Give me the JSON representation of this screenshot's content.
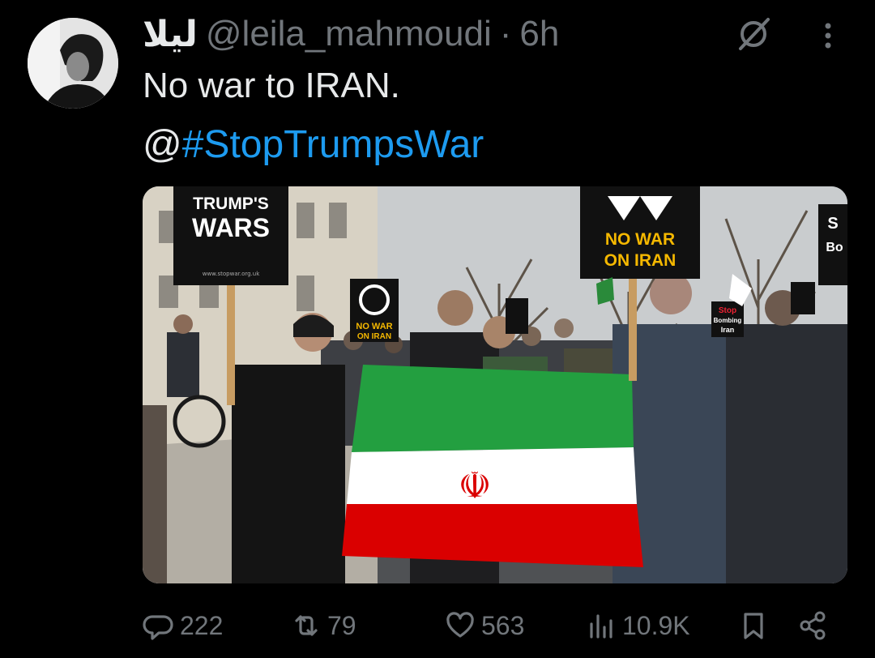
{
  "author": {
    "display_name": "ليلا",
    "handle": "@leila_mahmoudi",
    "separator": "·",
    "time": "6h"
  },
  "tweet": {
    "text": "No war to IRAN.",
    "mention_prefix": "@",
    "hashtag": "#StopTrumpsWar"
  },
  "media": {
    "sign_left_line1": "TRUMP'S",
    "sign_left_line2": "WARS",
    "sign_left_url": "www.stopwar.org.uk",
    "sign_right_line1": "NO WAR",
    "sign_right_line2": "ON IRAN",
    "sign_small_line1": "NO WAR",
    "sign_small_line2": "ON IRAN",
    "sign_far_right_line1": "S",
    "sign_far_right_line2": "Bo",
    "sign_stop": "Stop",
    "sign_bombing": "Bombing",
    "sign_iran": "Iran"
  },
  "actions": {
    "replies": "222",
    "reposts": "79",
    "likes": "563",
    "views": "10.9K"
  },
  "colors": {
    "link": "#1d9bf0",
    "muted": "#71767b",
    "flag_green": "#239f40",
    "flag_red": "#da0000",
    "sign_yellow": "#f5b800"
  }
}
